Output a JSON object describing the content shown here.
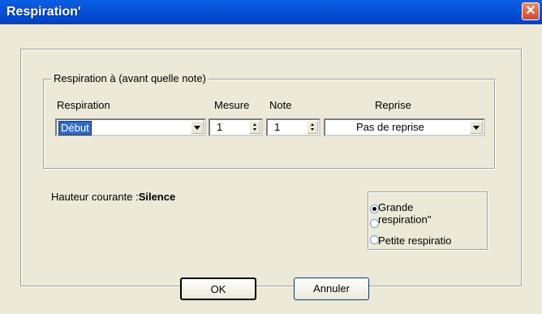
{
  "window": {
    "title": "Respiration'"
  },
  "group": {
    "legend": "Respiration à (avant quelle note)",
    "col_respiration": "Respiration",
    "col_mesure": "Mesure",
    "col_note": "Note",
    "col_reprise": "Reprise",
    "respiration_value": "Début",
    "mesure_value": "1",
    "note_value": "1",
    "reprise_value": "Pas de reprise"
  },
  "hauteur": {
    "label": "Hauteur courante :",
    "value": "Silence"
  },
  "radios": {
    "grande_line1": "Grande",
    "grande_line2": "respiration''",
    "petite": "Petite respiratio",
    "selected": "grande"
  },
  "buttons": {
    "ok": "OK",
    "annuler": "Annuler"
  }
}
